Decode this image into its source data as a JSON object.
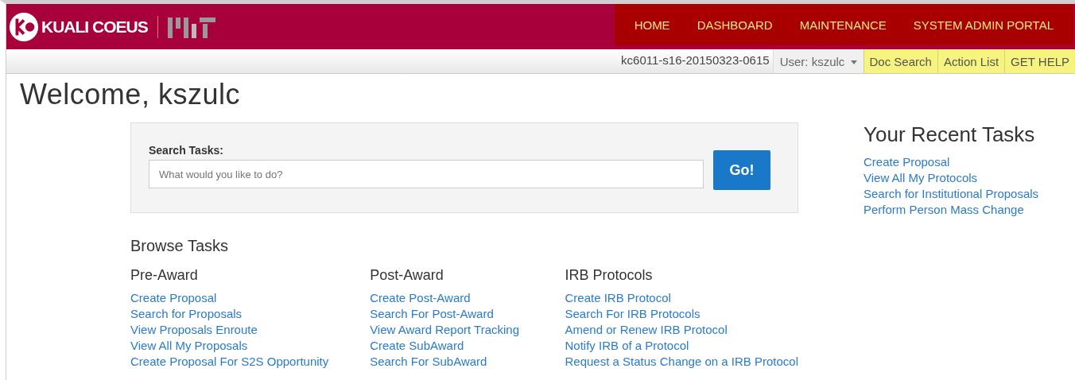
{
  "header": {
    "brand": "KUALI COEUS",
    "nav": [
      {
        "label": "HOME"
      },
      {
        "label": "DASHBOARD"
      },
      {
        "label": "MAINTENANCE"
      },
      {
        "label": "SYSTEM ADMIN PORTAL"
      }
    ]
  },
  "subbar": {
    "build": "kc6011-s16-20150323-0615",
    "user_menu": "User: kszulc",
    "links": [
      {
        "label": "Doc Search"
      },
      {
        "label": "Action List"
      },
      {
        "label": "GET HELP"
      }
    ]
  },
  "welcome": "Welcome, kszulc",
  "search": {
    "label": "Search Tasks:",
    "placeholder": "What would you like to do?",
    "button": "Go!"
  },
  "recent": {
    "title": "Your Recent Tasks",
    "items": [
      "Create Proposal",
      "View All My Protocols",
      "Search for Institutional Proposals",
      "Perform Person Mass Change"
    ]
  },
  "browse": {
    "title": "Browse Tasks",
    "columns": [
      {
        "title": "Pre-Award",
        "links": [
          "Create Proposal",
          "Search for Proposals",
          "View Proposals Enroute",
          "View All My Proposals",
          "Create Proposal For S2S Opportunity"
        ]
      },
      {
        "title": "Post-Award",
        "links": [
          "Create Post-Award",
          "Search For Post-Award",
          "View Award Report Tracking",
          "Create SubAward",
          "Search For SubAward"
        ]
      },
      {
        "title": "IRB Protocols",
        "links": [
          "Create IRB Protocol",
          "Search For IRB Protocols",
          "Amend or Renew IRB Protocol",
          "Notify IRB of a Protocol",
          "Request a Status Change on a IRB Protocol"
        ]
      }
    ]
  }
}
